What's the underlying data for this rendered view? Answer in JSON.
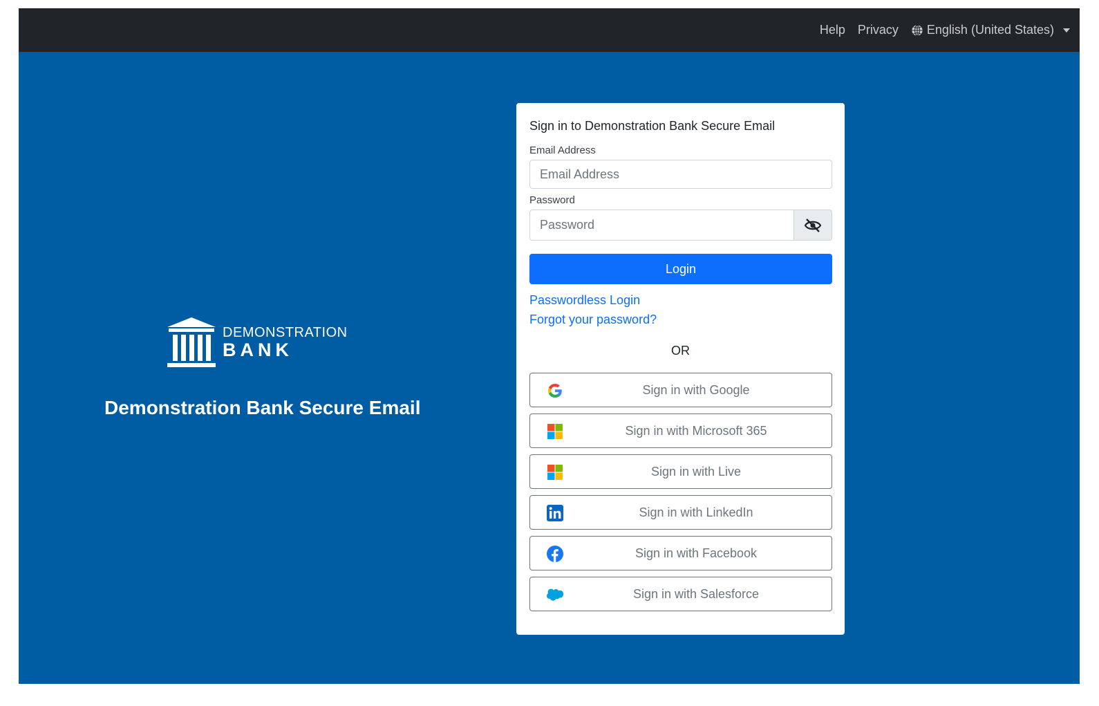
{
  "topbar": {
    "help": "Help",
    "privacy": "Privacy",
    "language": "English (United States)"
  },
  "brand": {
    "line1": "DEMONSTRATION",
    "line2": "BANK",
    "tagline": "Demonstration Bank Secure Email"
  },
  "login": {
    "title": "Sign in to Demonstration Bank Secure Email",
    "email_label": "Email Address",
    "email_placeholder": "Email Address",
    "password_label": "Password",
    "password_placeholder": "Password",
    "login_button": "Login",
    "passwordless_link": "Passwordless Login",
    "forgot_link": "Forgot your password?",
    "or": "OR"
  },
  "sso": [
    {
      "label": "Sign in with Google",
      "icon": "google-icon"
    },
    {
      "label": "Sign in with Microsoft 365",
      "icon": "microsoft-icon"
    },
    {
      "label": "Sign in with Live",
      "icon": "microsoft-icon"
    },
    {
      "label": "Sign in with LinkedIn",
      "icon": "linkedin-icon"
    },
    {
      "label": "Sign in with Facebook",
      "icon": "facebook-icon"
    },
    {
      "label": "Sign in with Salesforce",
      "icon": "salesforce-icon"
    }
  ],
  "colors": {
    "page_blue": "#005da3",
    "topbar": "#212529",
    "primary": "#0d6efd"
  }
}
